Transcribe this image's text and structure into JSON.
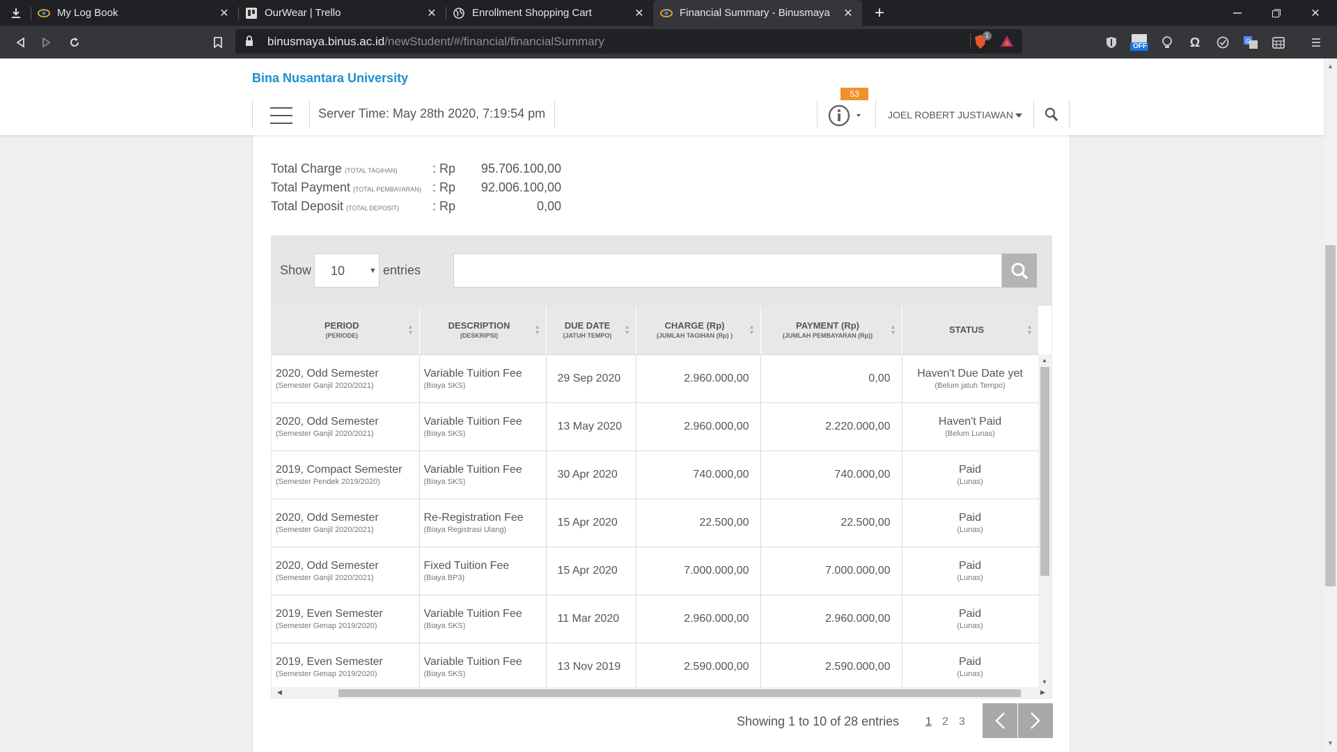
{
  "browser": {
    "tabs": [
      {
        "title": "My Log Book",
        "active": false
      },
      {
        "title": "OurWear | Trello",
        "active": false
      },
      {
        "title": "Enrollment Shopping Cart",
        "active": false
      },
      {
        "title": "Financial Summary - Binusmaya",
        "active": true
      }
    ],
    "url_host": "binusmaya.binus.ac.id",
    "url_path": "/newStudent/#/financial/financialSummary",
    "extension_badge": "OFF",
    "brave_count": "1"
  },
  "header": {
    "university": "Bina Nusantara University",
    "server_time": "Server Time: May 28th 2020, 7:19:54 pm",
    "notification_count": "53",
    "user_name": "JOEL ROBERT JUSTIAWAN"
  },
  "summary": {
    "currency": "Rp",
    "rows": [
      {
        "label": "Total Charge",
        "sub": "(TOTAL TAGIHAN)",
        "value": "95.706.100,00"
      },
      {
        "label": "Total Payment",
        "sub": "(TOTAL PEMBAYARAN)",
        "value": "92.006.100,00"
      },
      {
        "label": "Total Deposit",
        "sub": "(TOTAL DEPOSIT)",
        "value": "0,00"
      }
    ]
  },
  "table_controls": {
    "show_label": "Show",
    "entries_value": "10",
    "entries_label": "entries",
    "search_value": ""
  },
  "table": {
    "columns": [
      {
        "label": "PERIOD",
        "sub": "(PERIODE)"
      },
      {
        "label": "DESCRIPTION",
        "sub": "(DESKRIPSI)"
      },
      {
        "label": "DUE DATE",
        "sub": "(JATUH TEMPO)"
      },
      {
        "label": "CHARGE (Rp)",
        "sub": "(JUMLAH TAGIHAN (Rp) )"
      },
      {
        "label": "PAYMENT (Rp)",
        "sub": "(JUMLAH PEMBAYARAN (Rp))"
      },
      {
        "label": "STATUS",
        "sub": ""
      }
    ],
    "rows": [
      {
        "period": "2020, Odd Semester",
        "period_sub": "(Semester Ganjil 2020/2021)",
        "desc": "Variable Tuition Fee",
        "desc_sub": "(Biaya SKS)",
        "due": "29 Sep 2020",
        "charge": "2.960.000,00",
        "payment": "0,00",
        "status": "Haven't Due Date yet",
        "status_sub": "(Belum jatuh Tempo)"
      },
      {
        "period": "2020, Odd Semester",
        "period_sub": "(Semester Ganjil 2020/2021)",
        "desc": "Variable Tuition Fee",
        "desc_sub": "(Biaya SKS)",
        "due": "13 May 2020",
        "charge": "2.960.000,00",
        "payment": "2.220.000,00",
        "status": "Haven't Paid",
        "status_sub": "(Belum Lunas)"
      },
      {
        "period": "2019, Compact Semester",
        "period_sub": "(Semester Pendek 2019/2020)",
        "desc": "Variable Tuition Fee",
        "desc_sub": "(Biaya SKS)",
        "due": "30 Apr 2020",
        "charge": "740.000,00",
        "payment": "740.000,00",
        "status": "Paid",
        "status_sub": "(Lunas)"
      },
      {
        "period": "2020, Odd Semester",
        "period_sub": "(Semester Ganjil 2020/2021)",
        "desc": "Re-Registration Fee",
        "desc_sub": "(Biaya Registrasi Ulang)",
        "due": "15 Apr 2020",
        "charge": "22.500,00",
        "payment": "22.500,00",
        "status": "Paid",
        "status_sub": "(Lunas)"
      },
      {
        "period": "2020, Odd Semester",
        "period_sub": "(Semester Ganjil 2020/2021)",
        "desc": "Fixed Tuition Fee",
        "desc_sub": "(Biaya BP3)",
        "due": "15 Apr 2020",
        "charge": "7.000.000,00",
        "payment": "7.000.000,00",
        "status": "Paid",
        "status_sub": "(Lunas)"
      },
      {
        "period": "2019, Even Semester",
        "period_sub": "(Semester Genap 2019/2020)",
        "desc": "Variable Tuition Fee",
        "desc_sub": "(Biaya SKS)",
        "due": "11 Mar 2020",
        "charge": "2.960.000,00",
        "payment": "2.960.000,00",
        "status": "Paid",
        "status_sub": "(Lunas)"
      },
      {
        "period": "2019, Even Semester",
        "period_sub": "(Semester Genap 2019/2020)",
        "desc": "Variable Tuition Fee",
        "desc_sub": "(Biaya SKS)",
        "due": "13 Nov 2019",
        "charge": "2.590.000,00",
        "payment": "2.590.000,00",
        "status": "Paid",
        "status_sub": "(Lunas)"
      }
    ]
  },
  "pagination": {
    "info": "Showing 1 to 10 of 28 entries",
    "pages": [
      "1",
      "2",
      "3"
    ],
    "current": "1"
  },
  "colors": {
    "brand": "#1a8fcf",
    "badge": "#f0922b"
  }
}
